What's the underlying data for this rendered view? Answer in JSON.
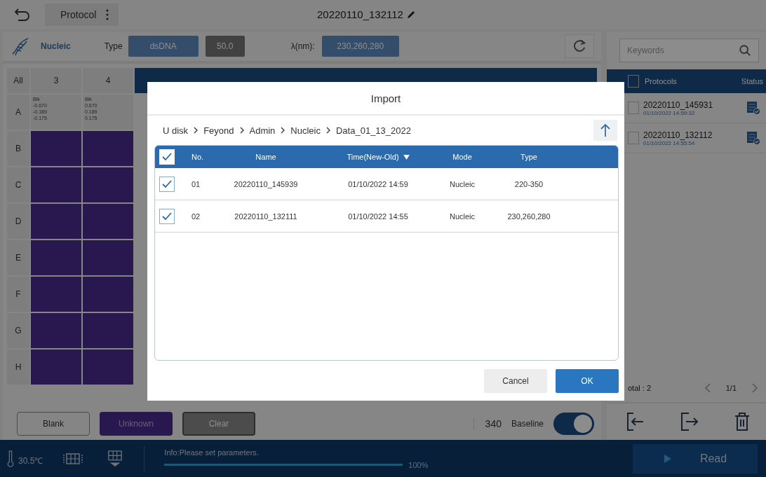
{
  "top_bar": {
    "menu": "Protocol",
    "file_name": "20220110_132112"
  },
  "sample_settings": {
    "mode": "Nucleic",
    "type_label": "Type",
    "type_value": "dsDNA",
    "factor": "50.0",
    "wavelength_label": "λ(nm):",
    "wavelength_value": "230,260,280"
  },
  "plate": {
    "corner": "All",
    "columns": [
      "3",
      "4"
    ],
    "rows": [
      {
        "label": "A",
        "wells": [
          {
            "kind": "blank",
            "lines": [
              "Blk",
              "-0.670",
              "-0.189",
              "-0.175"
            ]
          },
          {
            "kind": "blank",
            "lines": [
              "Blk",
              "0.670",
              "0.189",
              "0.175"
            ]
          }
        ]
      },
      {
        "label": "B",
        "wells": [
          {
            "kind": "unknown"
          },
          {
            "kind": "unknown"
          }
        ]
      },
      {
        "label": "C",
        "wells": [
          {
            "kind": "unknown"
          },
          {
            "kind": "unknown"
          }
        ]
      },
      {
        "label": "D",
        "wells": [
          {
            "kind": "unknown"
          },
          {
            "kind": "unknown"
          }
        ]
      },
      {
        "label": "E",
        "wells": [
          {
            "kind": "unknown"
          },
          {
            "kind": "unknown"
          }
        ]
      },
      {
        "label": "F",
        "wells": [
          {
            "kind": "unknown"
          },
          {
            "kind": "unknown"
          }
        ]
      },
      {
        "label": "G",
        "wells": [
          {
            "kind": "unknown"
          },
          {
            "kind": "unknown"
          }
        ]
      },
      {
        "label": "H",
        "wells": [
          {
            "kind": "unknown"
          },
          {
            "kind": "unknown"
          }
        ]
      }
    ]
  },
  "sample_buttons": [
    {
      "label": "Blank",
      "kind": "blank"
    },
    {
      "label": "Unknown",
      "kind": "unknown"
    },
    {
      "label": "Clear",
      "kind": "clear"
    }
  ],
  "baseline": {
    "wavelength": "340",
    "label": "Baseline",
    "on": true
  },
  "protocols": {
    "search": {
      "placeholder": "Keywords"
    },
    "columns": [
      "Protocols",
      "Status"
    ],
    "all_checked": false,
    "rows": [
      {
        "name": "20220110_145931",
        "time": "01/10/2022 14:59:32",
        "checked": false
      },
      {
        "name": "20220110_132112",
        "time": "01/10/2022 14:55:54",
        "checked": false
      }
    ],
    "total": "otal : 2",
    "page": "1/1"
  },
  "status_bar": {
    "temperature": "30.5℃",
    "info": "Info:Please set parameters.",
    "progress": {
      "level": 1,
      "reading": "100%"
    },
    "read_button": "Read"
  },
  "dialog": {
    "title": "Import",
    "breadcrumb": [
      "U disk",
      "Feyond",
      "Admin",
      "Nucleic",
      "Data_01_13_2022"
    ],
    "columns": [
      "No.",
      "Name",
      "Time(New-Old)",
      "Mode",
      "Type"
    ],
    "all_checked": true,
    "rows": [
      {
        "no": "01",
        "name": "20220110_145939",
        "time": "01/10/2022 14:59",
        "mode": "Nucleic",
        "type": "220-350",
        "checked": true
      },
      {
        "no": "02",
        "name": "20220110_132111",
        "time": "01/10/2022 14:55",
        "mode": "Nucleic",
        "type": "230,260,280",
        "checked": true
      }
    ],
    "buttons": [
      {
        "label": "Cancel",
        "kind": "secondary"
      },
      {
        "label": "OK",
        "kind": "primary"
      }
    ]
  }
}
